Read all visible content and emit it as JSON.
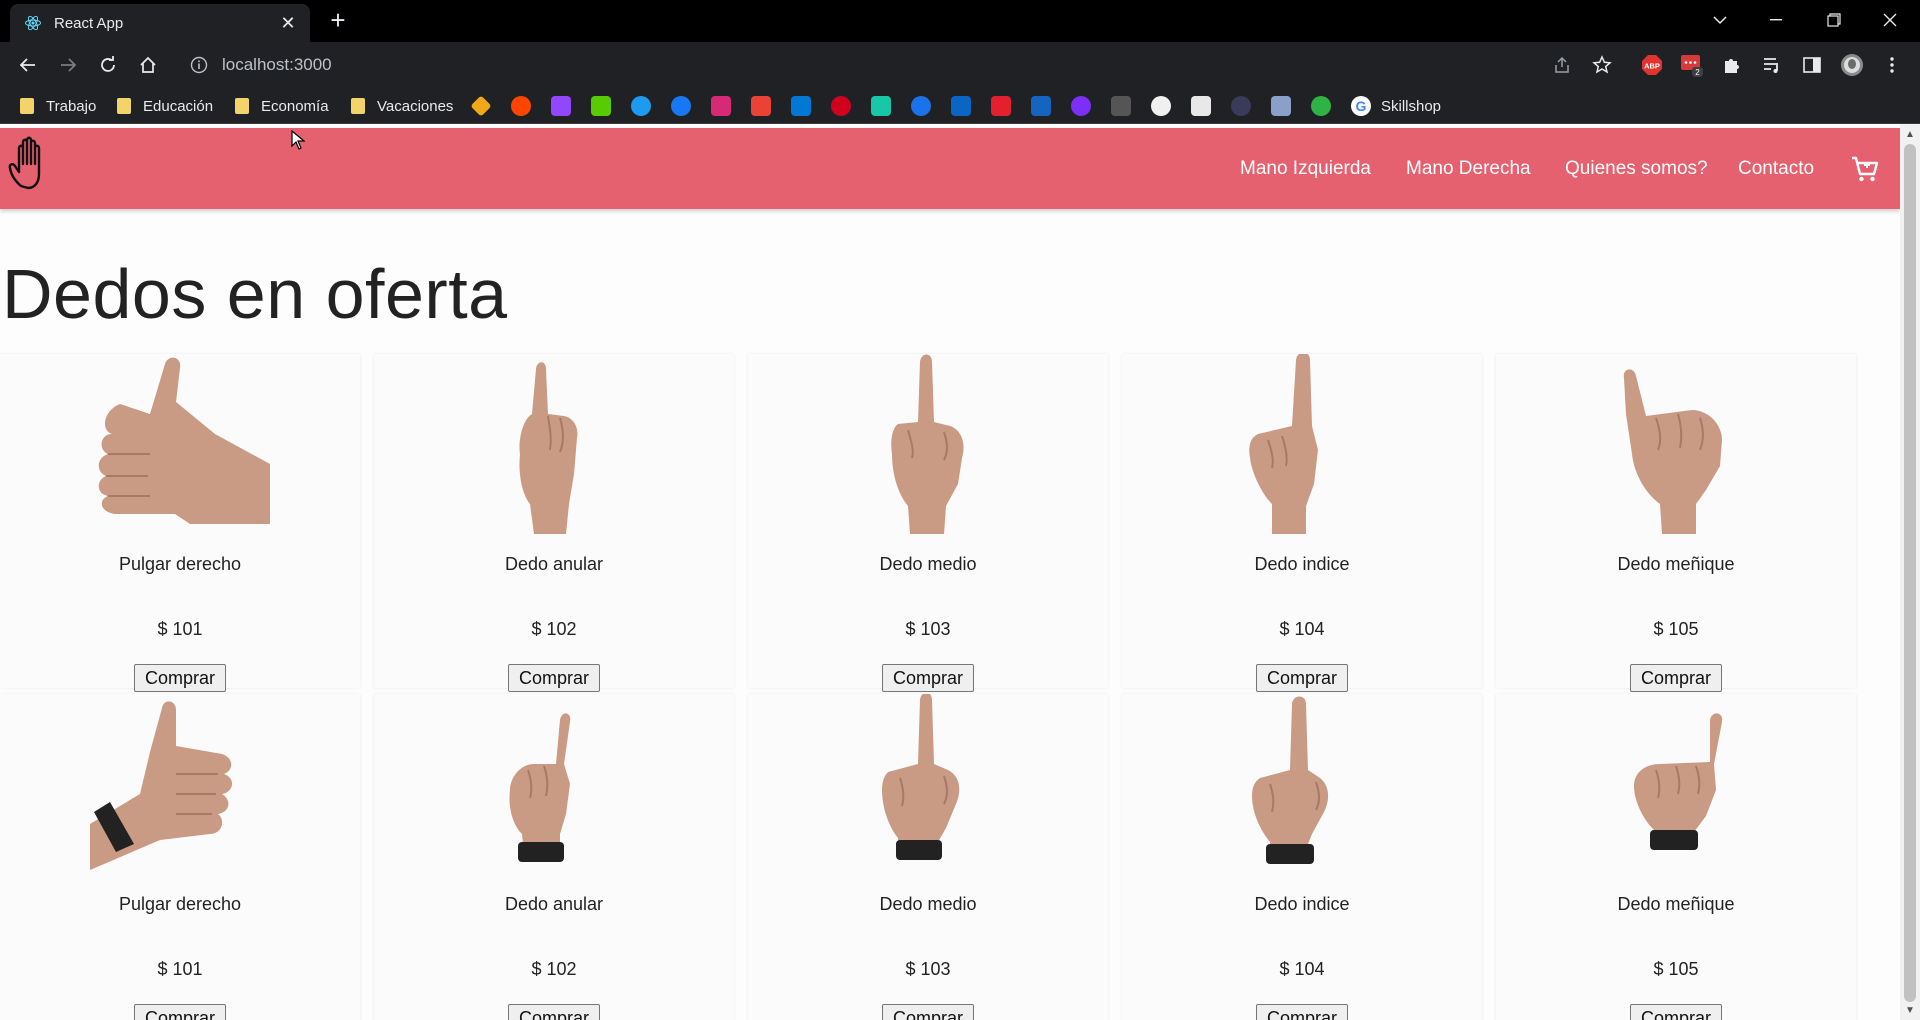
{
  "browser": {
    "tab_title": "React App",
    "url": "localhost:3000",
    "bookmarks": {
      "folders": [
        "Trabajo",
        "Educación",
        "Economía",
        "Vacaciones"
      ],
      "last_label": "Skillshop"
    },
    "extensions": {
      "abp_label": "ABP",
      "badge_count": "2"
    }
  },
  "site": {
    "nav": {
      "left": "Mano Izquierda",
      "right": "Mano Derecha",
      "about": "Quienes somos?",
      "contact": "Contacto"
    },
    "heading": "Dedos en oferta",
    "accent_color": "#e6616f",
    "buy_label": "Comprar",
    "products_row1": [
      {
        "name": "Pulgar derecho",
        "price": "$ 101",
        "icon": "thumb-up-hand"
      },
      {
        "name": "Dedo anular",
        "price": "$ 102",
        "icon": "ring-finger-hand"
      },
      {
        "name": "Dedo medio",
        "price": "$ 103",
        "icon": "middle-finger-hand"
      },
      {
        "name": "Dedo indice",
        "price": "$ 104",
        "icon": "index-finger-hand"
      },
      {
        "name": "Dedo meñique",
        "price": "$ 105",
        "icon": "pinky-finger-hand"
      }
    ],
    "products_row2": [
      {
        "name": "Pulgar derecho",
        "price": "$ 101",
        "icon": "thumb-up-hand-watch"
      },
      {
        "name": "Dedo anular",
        "price": "$ 102",
        "icon": "ring-finger-hand-watch"
      },
      {
        "name": "Dedo medio",
        "price": "$ 103",
        "icon": "middle-finger-hand-watch"
      },
      {
        "name": "Dedo indice",
        "price": "$ 104",
        "icon": "index-finger-hand-watch"
      },
      {
        "name": "Dedo meñique",
        "price": "$ 105",
        "icon": "pinky-finger-hand-watch"
      }
    ]
  }
}
